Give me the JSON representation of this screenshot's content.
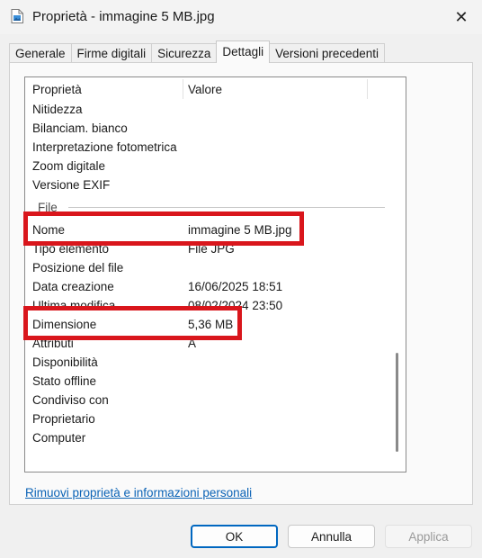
{
  "window": {
    "title": "Proprietà - immagine 5 MB.jpg"
  },
  "tabs": [
    {
      "label": "Generale"
    },
    {
      "label": "Firme digitali"
    },
    {
      "label": "Sicurezza"
    },
    {
      "label": "Dettagli"
    },
    {
      "label": "Versioni precedenti"
    }
  ],
  "active_tab": "Dettagli",
  "columns": {
    "name": "Proprietà",
    "value": "Valore"
  },
  "image_rows": [
    {
      "name": "Nitidezza",
      "value": ""
    },
    {
      "name": "Bilanciam. bianco",
      "value": ""
    },
    {
      "name": "Interpretazione fotometrica",
      "value": ""
    },
    {
      "name": "Zoom digitale",
      "value": ""
    },
    {
      "name": "Versione EXIF",
      "value": ""
    }
  ],
  "group_file": "File",
  "file_rows": [
    {
      "name": "Nome",
      "value": "immagine 5 MB.jpg"
    },
    {
      "name": "Tipo elemento",
      "value": "File JPG"
    },
    {
      "name": "Posizione del file",
      "value": ""
    },
    {
      "name": "Data creazione",
      "value": "16/06/2025 18:51"
    },
    {
      "name": "Ultima modifica",
      "value": "08/02/2024 23:50"
    },
    {
      "name": "Dimensione",
      "value": "5,36 MB"
    },
    {
      "name": "Attributi",
      "value": "A"
    },
    {
      "name": "Disponibilità",
      "value": ""
    },
    {
      "name": "Stato offline",
      "value": ""
    },
    {
      "name": "Condiviso con",
      "value": ""
    },
    {
      "name": "Proprietario",
      "value": ""
    },
    {
      "name": "Computer",
      "value": ""
    }
  ],
  "link": "Rimuovi proprietà e informazioni personali",
  "buttons": {
    "ok": "OK",
    "cancel": "Annulla",
    "apply": "Applica"
  },
  "colors": {
    "highlight": "#d9161c",
    "accent": "#0067c0",
    "link": "#0b63b6"
  }
}
